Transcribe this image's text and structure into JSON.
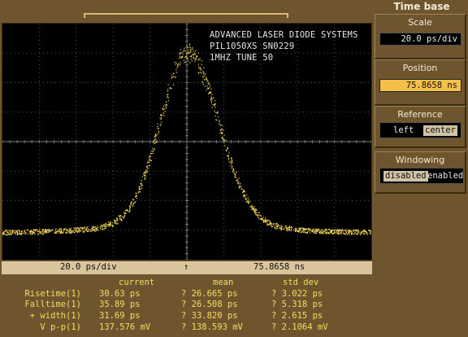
{
  "side_title": "Time base",
  "scale": {
    "title": "Scale",
    "value": "20.0 ps/div"
  },
  "position": {
    "title": "Position",
    "value": "75.8658 ns"
  },
  "reference": {
    "title": "Reference",
    "options": [
      "left",
      "center"
    ],
    "selected": "center"
  },
  "windowing": {
    "title": "Windowing",
    "options": [
      "disabled",
      "enabled"
    ],
    "selected": "disabled"
  },
  "header_lines": [
    "ADVANCED LASER DIODE SYSTEMS",
    "PIL1050XS SN0229",
    "1MHZ TUNE 50"
  ],
  "status": {
    "scale": "20.0 ps/div",
    "marker": "↑",
    "position": "75.8658 ns"
  },
  "colors": {
    "trace": "#f7d75a",
    "grid": "#4f4f4f",
    "background": "#000000"
  },
  "measurements": {
    "headers": {
      "current": "current",
      "mean": "mean",
      "std_dev": "std dev"
    },
    "rows": [
      {
        "label": "Risetime(1)",
        "current": "30.63 ps",
        "mean": "? 26.665 ps",
        "std": "? 3.022 ps"
      },
      {
        "label": "Falltime(1)",
        "current": "35.89 ps",
        "mean": "? 26.508 ps",
        "std": "? 5.318 ps"
      },
      {
        "label": "+ width(1)",
        "current": "31.69 ps",
        "mean": "? 33.820 ps",
        "std": "? 2.615 ps"
      },
      {
        "label": "V p-p(1)",
        "current": "137.576 mV",
        "mean": "? 138.593 mV",
        "std": "? 2.1064 mV"
      }
    ]
  }
}
